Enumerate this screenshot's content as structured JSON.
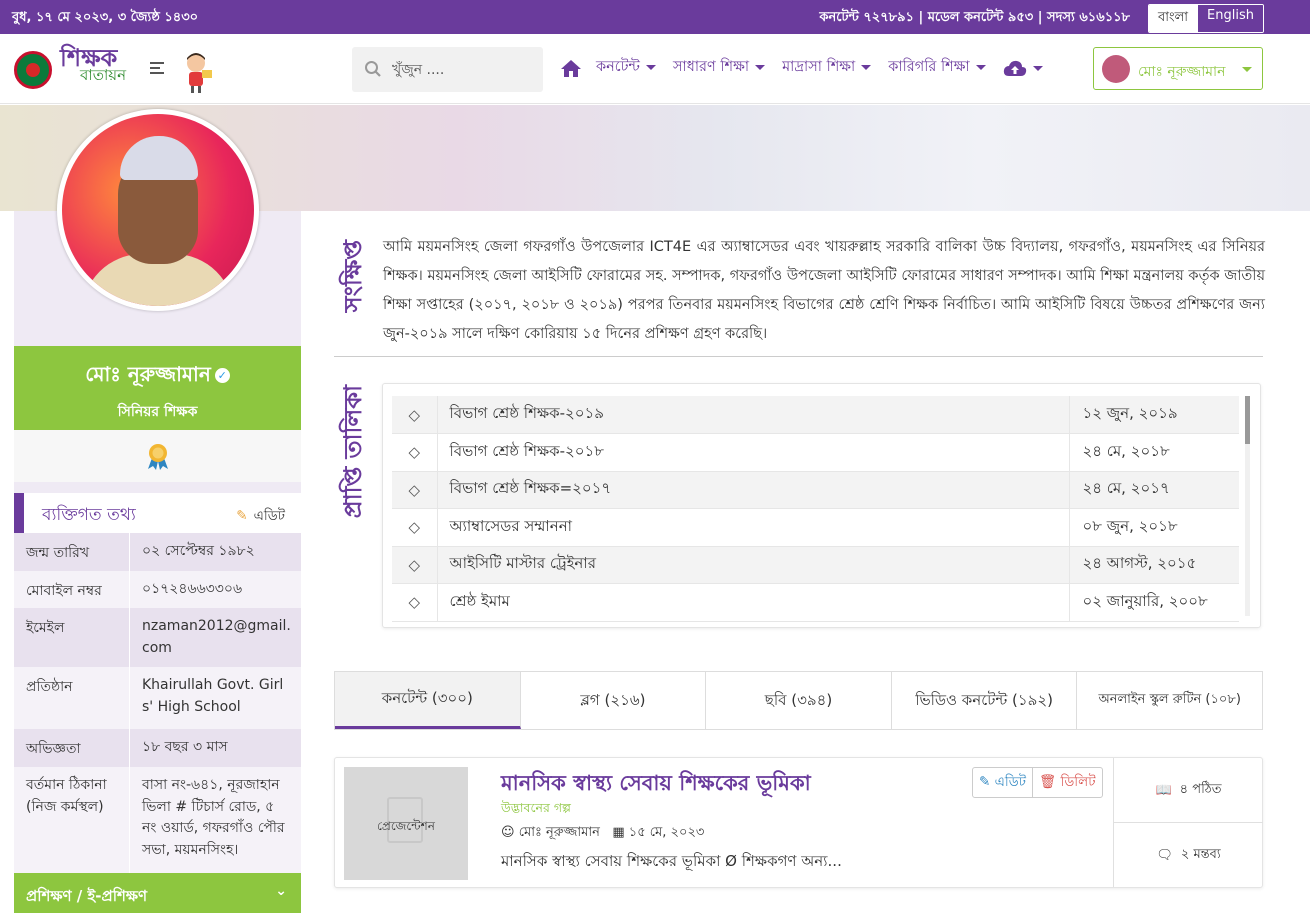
{
  "topbar": {
    "date": "বুধ, ১৭ মে ২০২৩, ৩ জ্যৈষ্ঠ ১৪৩০",
    "stats": "কনটেন্ট ৭২৭৮৯১ | মডেল কনটেন্ট ৯৫৩ | সদস্য ৬১৬১১৮",
    "lang_bn": "বাংলা",
    "lang_en": "English"
  },
  "nav": {
    "logo_line1": "শিক্ষক",
    "logo_line2": "বাতায়ন",
    "search_placeholder": "খুঁজুন ....",
    "menu": [
      "কনটেন্ট",
      "সাধারণ শিক্ষা",
      "মাদ্রাসা শিক্ষা",
      "কারিগরি শিক্ষা"
    ],
    "user_name": "মোঃ নূরুজ্জামান"
  },
  "profile": {
    "name": "মোঃ নূরুজ্জামান",
    "rank": "সিনিয়র শিক্ষক",
    "info_title": "ব্যক্তিগত তথ্য",
    "edit_label": "এডিট",
    "info": [
      {
        "label": "জন্ম তারিখ",
        "value": "০২ সেপ্টেম্বর ১৯৮২"
      },
      {
        "label": "মোবাইল নম্বর",
        "value": "০১৭২৪৬৬৩৩০৬"
      },
      {
        "label": "ইমেইল",
        "value": "nzaman2012@gmail.com"
      },
      {
        "label": "প্রতিষ্ঠান",
        "value": "Khairullah Govt. Girls' High School"
      },
      {
        "label": "অভিজ্ঞতা",
        "value": "১৮ বছর ৩ মাস"
      },
      {
        "label": "বর্তমান ঠিকানা (নিজ কর্মস্থল)",
        "value": "বাসা নং-৬৪১, নূরজাহান ভিলা # টিচার্স রোড, ৫ নং ওয়ার্ড, গফরগাঁও পৌরসভা, ময়মনসিংহ।"
      }
    ],
    "training_label": "প্রশিক্ষণ / ই-প্রশিক্ষণ"
  },
  "about": {
    "vertical_label": "সংক্ষিপ্ত",
    "text": "আমি ময়মনসিংহ জেলা গফরগাঁও উপজেলার ICT4E এর অ্যাম্বাসেডর এবং খায়রুল্লাহ সরকারি বালিকা উচ্চ বিদ্যালয়, গফরগাঁও, ময়মনসিংহ এর সিনিয়র শিক্ষক। ময়মনসিংহ জেলা আইসিটি ফোরামের সহ. সম্পাদক, গফরগাঁও উপজেলা আইসিটি ফোরামের সাধারণ সম্পাদক। আমি শিক্ষা মন্ত্রনালয় কর্তৃক জাতীয় শিক্ষা সপ্তাহের (২০১৭, ২০১৮ ও ২০১৯) পরপর তিনবার ময়মনসিংহ বিভাগের শ্রেষ্ঠ শ্রেণি শিক্ষক নির্বাচিত। আমি আইসিটি বিষয়ে উচ্চতর প্রশিক্ষণের জন্য জুন-২০১৯ সালে দক্ষিণ কোরিয়ায় ১৫ দিনের প্রশিক্ষণ গ্রহণ করেছি।"
  },
  "achievements": {
    "vertical_label": "প্রাপ্তি তালিকা",
    "rows": [
      {
        "title": "বিভাগ শ্রেষ্ঠ শিক্ষক-২০১৯",
        "date": "১২ জুন, ২০১৯"
      },
      {
        "title": "বিভাগ শ্রেষ্ঠ শিক্ষক-২০১৮",
        "date": "২৪ মে, ২০১৮"
      },
      {
        "title": "বিভাগ শ্রেষ্ঠ শিক্ষক=২০১৭",
        "date": "২৪ মে, ২০১৭"
      },
      {
        "title": "অ্যাম্বাসেডর সম্মাননা",
        "date": "০৮ জুন, ২০১৮"
      },
      {
        "title": "আইসিটি মাস্টার ট্রেইনার",
        "date": "২৪ আগস্ট, ২০১৫"
      },
      {
        "title": "শ্রেষ্ঠ ইমাম",
        "date": "০২ জানুয়ারি, ২০০৮"
      }
    ]
  },
  "tabs": [
    "কনটেন্ট (৩০০)",
    "ব্লগ (২১৬)",
    "ছবি (৩৯৪)",
    "ভিডিও কনটেন্ট (১৯২)",
    "অনলাইন স্কুল রুটিন (১০৮)"
  ],
  "content_card": {
    "thumb_label": "প্রেজেন্টেশন",
    "title": "মানসিক স্বাস্থ্য সেবায় শিক্ষকের ভূমিকা",
    "category": "উদ্ভাবনের গল্প",
    "author": "মোঃ নূরুজ্জামান",
    "date": "১৫ মে, ২০২৩",
    "desc": "মানসিক স্বাস্থ্য সেবায় শিক্ষকের ভূমিকা Ø শিক্ষকগণ অন্য...",
    "edit_label": "এডিট",
    "delete_label": "ডিলিট",
    "reads": "৪ পঠিত",
    "comments": "২ মন্তব্য"
  },
  "colors": {
    "primary": "#6a3b9c",
    "accent": "#8dc63f"
  }
}
